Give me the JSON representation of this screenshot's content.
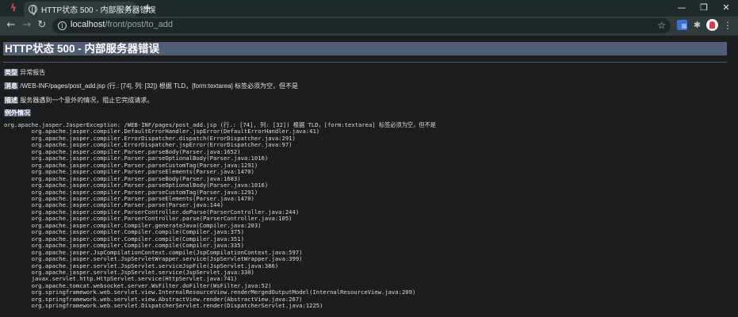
{
  "browser": {
    "tab": {
      "title": "HTTP状态 500 - 内部服务器错误",
      "close": "✕"
    },
    "new_tab": "+",
    "window_controls": {
      "minimize": "—",
      "maximize": "❐",
      "close": "✕"
    },
    "address": {
      "host": "localhost",
      "path": "/front/post/to_add"
    },
    "icons": [
      "app-icon",
      "globe-icon",
      "back-icon",
      "forward-icon",
      "reload-icon",
      "info-icon",
      "star-icon",
      "extension-icon",
      "puzzle-icon",
      "avatar",
      "menu-icon"
    ]
  },
  "page": {
    "title": "HTTP状态 500 - 内部服务器错误",
    "type_label": "类型",
    "type_value": "异常报告",
    "message_label": "消息",
    "message_value": "/WEB-INF/pages/post_add.jsp (行.: [74], 列: [32]) 根据 TLD，[form:textarea] 标签必须为空，但不是",
    "description_label": "描述",
    "description_value": "服务器遇到一个意外的情况，阻止它完成请求。",
    "exception_label": "例外情况",
    "stack_trace": [
      "org.apache.jasper.JasperException: /WEB-INF/pages/post_add.jsp (行.: [74], 列: [32]) 根据 TLD，[form:textarea] 标签必须为空，但不是",
      "\torg.apache.jasper.compiler.DefaultErrorHandler.jspError(DefaultErrorHandler.java:41)",
      "\torg.apache.jasper.compiler.ErrorDispatcher.dispatch(ErrorDispatcher.java:291)",
      "\torg.apache.jasper.compiler.ErrorDispatcher.jspError(ErrorDispatcher.java:97)",
      "\torg.apache.jasper.compiler.Parser.parseBody(Parser.java:1652)",
      "\torg.apache.jasper.compiler.Parser.parseOptionalBody(Parser.java:1016)",
      "\torg.apache.jasper.compiler.Parser.parseCustomTag(Parser.java:1291)",
      "\torg.apache.jasper.compiler.Parser.parseElements(Parser.java:1470)",
      "\torg.apache.jasper.compiler.Parser.parseBody(Parser.java:1683)",
      "\torg.apache.jasper.compiler.Parser.parseOptionalBody(Parser.java:1016)",
      "\torg.apache.jasper.compiler.Parser.parseCustomTag(Parser.java:1291)",
      "\torg.apache.jasper.compiler.Parser.parseElements(Parser.java:1470)",
      "\torg.apache.jasper.compiler.Parser.parse(Parser.java:144)",
      "\torg.apache.jasper.compiler.ParserController.doParse(ParserController.java:244)",
      "\torg.apache.jasper.compiler.ParserController.parse(ParserController.java:105)",
      "\torg.apache.jasper.compiler.Compiler.generateJava(Compiler.java:203)",
      "\torg.apache.jasper.compiler.Compiler.compile(Compiler.java:375)",
      "\torg.apache.jasper.compiler.Compiler.compile(Compiler.java:351)",
      "\torg.apache.jasper.compiler.Compiler.compile(Compiler.java:335)",
      "\torg.apache.jasper.JspCompilationContext.compile(JspCompilationContext.java:597)",
      "\torg.apache.jasper.servlet.JspServletWrapper.service(JspServletWrapper.java:399)",
      "\torg.apache.jasper.servlet.JspServlet.serviceJspFile(JspServlet.java:386)",
      "\torg.apache.jasper.servlet.JspServlet.service(JspServlet.java:330)",
      "\tjavax.servlet.http.HttpServlet.service(HttpServlet.java:741)",
      "\torg.apache.tomcat.websocket.server.WsFilter.doFilter(WsFilter.java:52)",
      "\torg.springframework.web.servlet.view.InternalResourceView.renderMergedOutputModel(InternalResourceView.java:209)",
      "\torg.springframework.web.servlet.view.AbstractView.render(AbstractView.java:267)",
      "\torg.springframework.web.servlet.DispatcherServlet.render(DispatcherServlet.java:1225)"
    ]
  }
}
